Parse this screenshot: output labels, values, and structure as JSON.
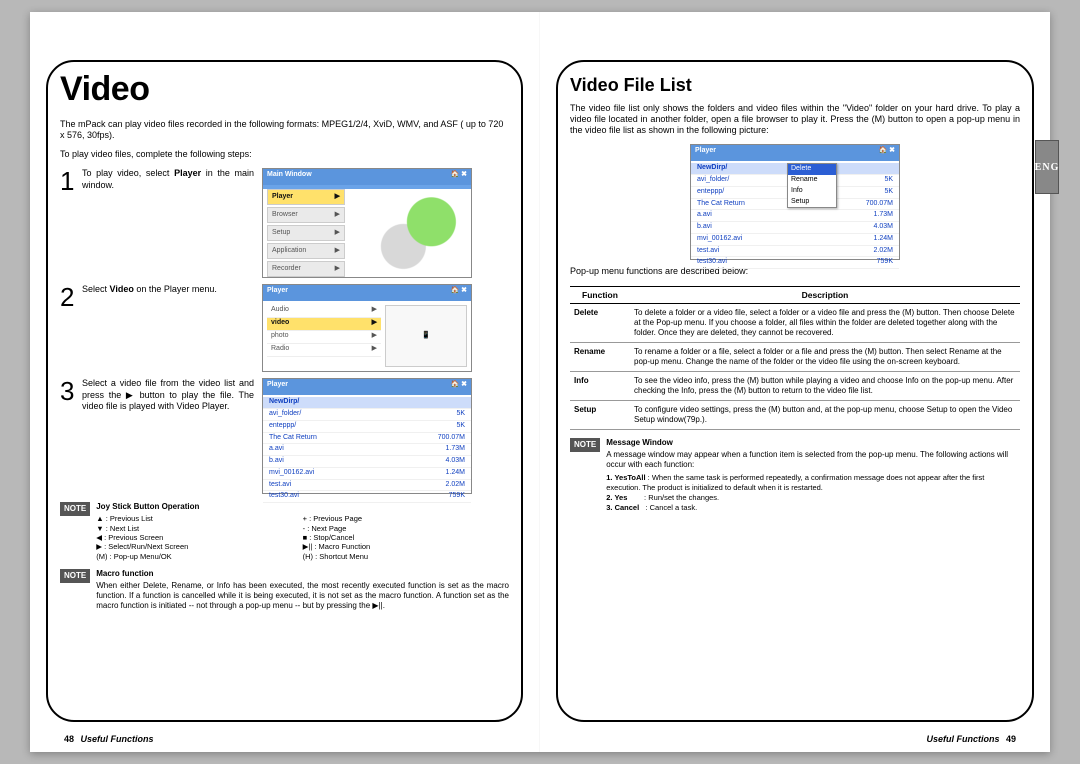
{
  "left": {
    "title": "Video",
    "intro1": "The mPack can play video files recorded in the following formats: MPEG1/2/4, XviD, WMV, and ASF ( up to 720 x 576, 30fps).",
    "intro2": "To play video files, complete the following steps:",
    "steps": [
      {
        "num": "1",
        "text_pre": "To play video, select ",
        "bold": "Player",
        "text_post": " in the main window."
      },
      {
        "num": "2",
        "text_pre": "Select ",
        "bold": "Video",
        "text_post": " on the Player menu."
      },
      {
        "num": "3",
        "text_pre": "Select a video file from the video list and press the ▶ button to play the file. The video file is played with Video Player.",
        "bold": "",
        "text_post": ""
      }
    ],
    "screenshot_main": {
      "title": "Main Window",
      "menu": [
        "Player",
        "Browser",
        "Setup",
        "Application",
        "Recorder"
      ],
      "selected": 0
    },
    "screenshot_player": {
      "title": "Player",
      "rows": [
        "Audio",
        "video",
        "photo",
        "Radio"
      ],
      "selected": 1
    },
    "screenshot_files": {
      "title": "Player",
      "header": "NewDirp/",
      "rows": [
        {
          "name": "avi_folder/",
          "size": "5K"
        },
        {
          "name": "enteppp/",
          "size": "5K"
        },
        {
          "name": "The Cat Return",
          "size": "700.07M"
        },
        {
          "name": "a.avi",
          "size": "1.73M"
        },
        {
          "name": "b.avi",
          "size": "4.03M"
        },
        {
          "name": "mvi_00162.avi",
          "size": "1.24M"
        },
        {
          "name": "test.avi",
          "size": "2.02M"
        },
        {
          "name": "test30.avi",
          "size": "759K"
        }
      ]
    },
    "note_joy": {
      "title": "Joy Stick Button Operation",
      "left_col": [
        "▲ : Previous List",
        "▼ : Next List",
        "◀ : Previous Screen",
        "▶ : Select/Run/Next Screen",
        "(M) : Pop-up Menu/OK"
      ],
      "right_col": [
        "+ : Previous Page",
        "- : Next Page",
        "■ : Stop/Cancel",
        "▶|| : Macro Function",
        "(H) : Shortcut Menu"
      ]
    },
    "note_macro": {
      "title": "Macro function",
      "body": "When either Delete, Rename, or Info has been executed, the most recently executed function is set as the macro function. If a function is cancelled while it is being executed, it is not set as the macro function. A function set as the macro function is initiated -- not through a pop-up menu -- but by pressing the ▶||."
    },
    "footer_section_label": "Useful Functions",
    "footer_page": "48"
  },
  "right": {
    "title": "Video File List",
    "intro": "The video file list only shows the folders and video files within the \"Video\" folder on your hard drive. To play a video file located in another folder, open a file browser to play it. Press the (M) button to open a pop-up menu in the video file list as shown in the following picture:",
    "popup_shot": {
      "title": "Player",
      "header": "NewDirp/",
      "rows": [
        {
          "name": "avi_folder/",
          "size": "5K"
        },
        {
          "name": "enteppp/",
          "size": "5K"
        },
        {
          "name": "The Cat Return",
          "size": "700.07M"
        },
        {
          "name": "a.avi",
          "size": "1.73M"
        },
        {
          "name": "b.avi",
          "size": "4.03M"
        },
        {
          "name": "mvi_00162.avi",
          "size": "1.24M"
        },
        {
          "name": "test.avi",
          "size": "2.02M"
        },
        {
          "name": "test30.avi",
          "size": "759K"
        }
      ],
      "popup": [
        "Delete",
        "Rename",
        "Info",
        "Setup"
      ],
      "popup_selected": 0
    },
    "popup_caption": "Pop-up menu functions are described below:",
    "table_headers": {
      "col1": "Function",
      "col2": "Description"
    },
    "table_rows": [
      {
        "fn": "Delete",
        "desc": "To delete a folder or a video file, select a folder or a video file and press the (M) button. Then choose Delete at the Pop-up menu. If you choose a folder, all files within the folder are deleted together along with the folder. Once they are deleted, they cannot be recovered."
      },
      {
        "fn": "Rename",
        "desc": "To rename a folder or a file, select a folder or a file and press the (M) button. Then select Rename at the pop-up menu. Change the name of the folder or the video file using the on-screen keyboard."
      },
      {
        "fn": "Info",
        "desc": "To see the video info, press the (M) button while playing a video and choose Info on the pop-up menu. After checking the Info, press the (M) button to return to the video file list."
      },
      {
        "fn": "Setup",
        "desc": "To configure video settings, press the (M) button and, at the pop-up menu, choose Setup to open the Video Setup window(79p.)."
      }
    ],
    "note_msg": {
      "title": "Message Window",
      "intro": "A message window may appear when a function item is selected from the pop-up menu. The following actions will occur with each function:",
      "items": [
        {
          "label": "1.  YesToAll",
          "sep": ":",
          "desc": "When the same task is performed repeatedly, a confirmation message does not appear after the first execution. The product is initialized to default when it is restarted."
        },
        {
          "label": "2.  Yes",
          "sep": ":",
          "desc": "Run/set the changes."
        },
        {
          "label": "3.  Cancel",
          "sep": ":",
          "desc": "Cancel a task."
        }
      ]
    },
    "lang": "ENG",
    "footer_section_label": "Useful Functions",
    "footer_page": "49"
  }
}
